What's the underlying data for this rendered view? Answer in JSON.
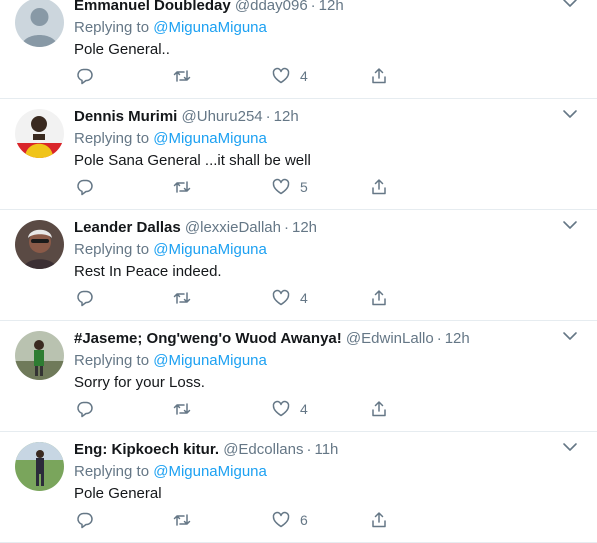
{
  "replies": [
    {
      "name": "Emmanuel Doubleday",
      "handle": "@dday096",
      "time": "12h",
      "replying_prefix": "Replying to",
      "replying_to": "@MigunaMiguna",
      "text": "Pole General..",
      "like_count": "4",
      "avatar": "default-avatar"
    },
    {
      "name": "Dennis Murimi",
      "handle": "@Uhuru254",
      "time": "12h",
      "replying_prefix": "Replying to",
      "replying_to": "@MigunaMiguna",
      "text": "Pole Sana General ...it shall be well",
      "like_count": "5",
      "avatar": "photo-man-yellow"
    },
    {
      "name": "Leander Dallas",
      "handle": "@lexxieDallah",
      "time": "12h",
      "replying_prefix": "Replying to",
      "replying_to": "@MigunaMiguna",
      "text": "Rest In Peace indeed.",
      "like_count": "4",
      "avatar": "photo-woman"
    },
    {
      "name": "#Jaseme; Ong'weng'o Wuod Awanya!",
      "handle": "@EdwinLallo",
      "time": "12h",
      "replying_prefix": "Replying to",
      "replying_to": "@MigunaMiguna",
      "text": "Sorry for your Loss.",
      "like_count": "4",
      "avatar": "photo-outdoor-man"
    },
    {
      "name": "Eng: Kipkoech kitur.",
      "handle": "@Edcollans",
      "time": "11h",
      "replying_prefix": "Replying to",
      "replying_to": "@MigunaMiguna",
      "text": "Pole General",
      "like_count": "6",
      "avatar": "photo-man-suit"
    }
  ],
  "colors": {
    "link": "#1da1f2",
    "secondary_text": "#657786",
    "divider": "#e6ecf0"
  },
  "icons": [
    "reply-icon",
    "retweet-icon",
    "like-icon",
    "share-icon",
    "chevron-down-icon"
  ]
}
